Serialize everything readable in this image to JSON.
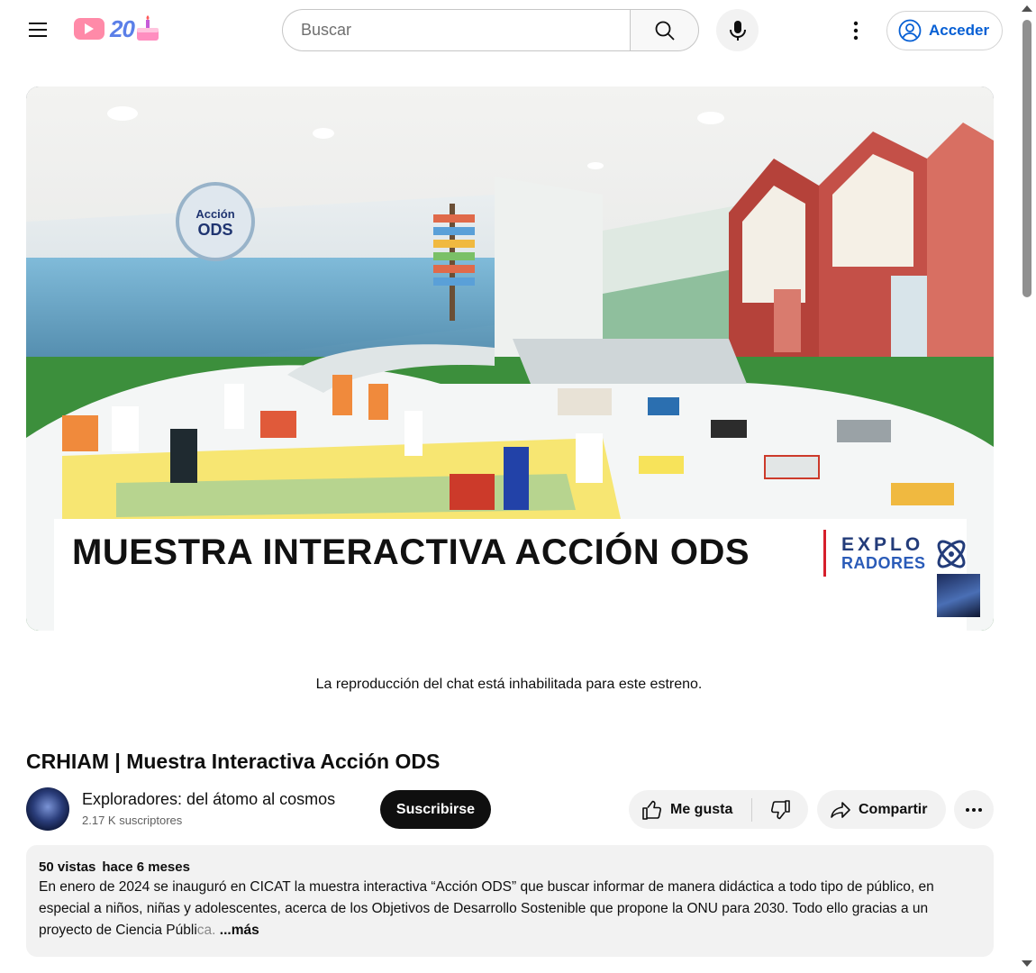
{
  "header": {
    "logo_text": "20",
    "search_placeholder": "Buscar",
    "signin_label": "Acceder"
  },
  "player": {
    "banner_title": "MUESTRA INTERACTIVA ACCIÓN ODS",
    "brand_line1": "EXPLO",
    "brand_line2": "RADORES",
    "sign_text_line1": "Acción",
    "sign_text_line2": "ODS"
  },
  "chat_note": "La reproducción del chat está inhabilitada para este estreno.",
  "video": {
    "title": "CRHIAM | Muestra Interactiva Acción ODS",
    "channel_name": "Exploradores: del átomo al cosmos",
    "subscribers": "2.17 K suscriptores",
    "subscribe_label": "Suscribirse",
    "like_label": "Me gusta",
    "share_label": "Compartir"
  },
  "description": {
    "views": "50 vistas",
    "age": "hace 6 meses",
    "text": "En enero de 2024 se inauguró en CICAT la muestra interactiva “Acción ODS” que buscar informar de manera didáctica a todo tipo de público, en especial a niños, niñas y adolescentes, acerca de los Objetivos de Desarrollo Sostenible que propone la ONU para 2030. Todo ello gracias a un proyecto de Ciencia Públi",
    "fade_text": "ca.",
    "more_label": "...más"
  },
  "colors": {
    "accent_link": "#065fd4",
    "subscribe_bg": "#0f0f0f",
    "chip_bg": "#f2f2f2",
    "brand_red": "#d61f2b"
  }
}
